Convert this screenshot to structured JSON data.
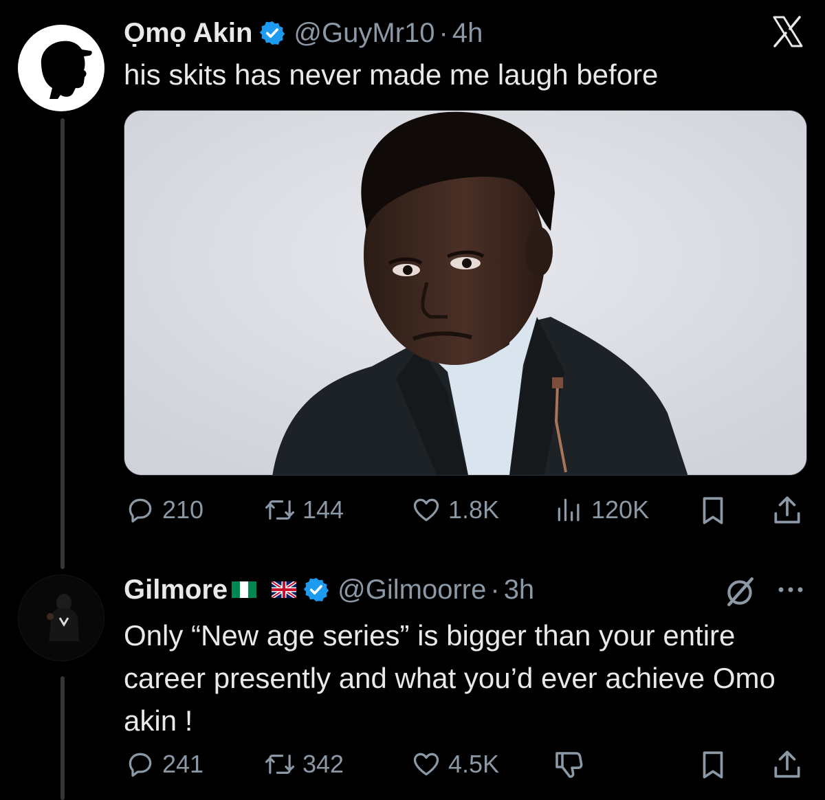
{
  "app_logo": "x-logo-icon",
  "thread": {
    "main_post": {
      "display_name": "Ọmọ Akin",
      "handle": "@GuyMr10",
      "separator": "·",
      "time": "4h",
      "text": "his skits has never made me laugh before",
      "media": {
        "kind": "photo"
      },
      "actions": {
        "replies": "210",
        "reposts": "144",
        "likes": "1.8K",
        "views": "120K"
      }
    },
    "reply_post": {
      "display_name": "Gilmore",
      "flags": [
        "nigeria-flag-icon",
        "uk-flag-icon"
      ],
      "handle": "@Gilmoorre",
      "separator": "·",
      "time": "3h",
      "text": "Only “New age series” is bigger than your entire career presently and what you’d ever achieve Omo akin !",
      "actions": {
        "replies": "241",
        "reposts": "342",
        "likes": "4.5K"
      }
    }
  },
  "colors": {
    "background": "#000000",
    "text_primary": "#e7e9ea",
    "text_secondary": "#8b98a5",
    "verified": "#1d9bf0",
    "thread_line": "#333639"
  }
}
